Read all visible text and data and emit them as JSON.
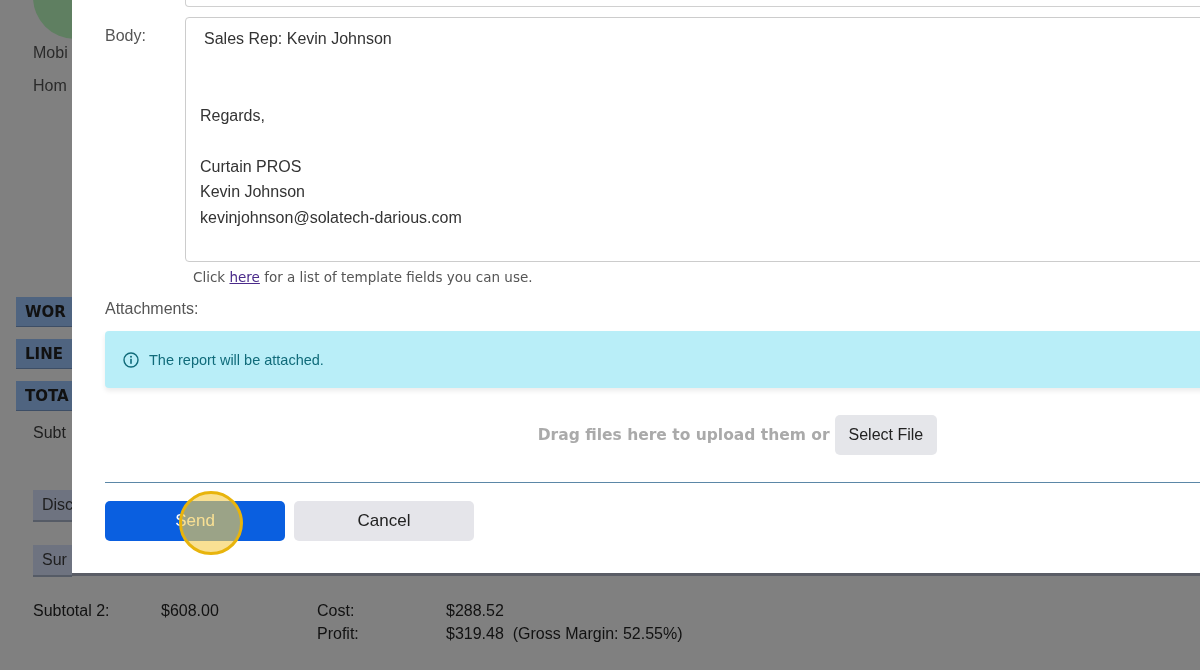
{
  "background": {
    "contact_lines": [
      "Mobi",
      "Hom"
    ],
    "sections": [
      "WOR",
      "LINE",
      "TOTA"
    ],
    "subtotal_label": "Subt",
    "adjustment_rows": [
      "Disc",
      "Sur"
    ],
    "summary_left": {
      "label": "Subtotal 2:",
      "value": "$608.00"
    },
    "summary_right": [
      {
        "label": "Cost:",
        "value": "$288.52"
      },
      {
        "label": "Profit:",
        "value": "$319.48  (Gross Margin: 52.55%)"
      }
    ]
  },
  "modal": {
    "body_label": "Body:",
    "body_paragraphs": [
      {
        "lines": [
          "Sales Rep: Kevin Johnson"
        ]
      },
      {
        "lines": [
          "Regards,"
        ]
      },
      {
        "lines": [
          "Curtain PROS",
          "Kevin Johnson",
          "kevinjohnson@solatech-darious.com"
        ]
      }
    ],
    "hint": {
      "before": "Click",
      "link": "here",
      "after": "for a list of template fields you can use."
    },
    "attachments_label": "Attachments:",
    "info": "The report will be attached.",
    "drop_text": "Drag files here to upload them or",
    "select_button": "Select File",
    "buttons": [
      {
        "label": "Send",
        "kind": "primary",
        "clicked": true
      },
      {
        "label": "Cancel",
        "kind": "secondary",
        "clicked": false
      }
    ]
  }
}
